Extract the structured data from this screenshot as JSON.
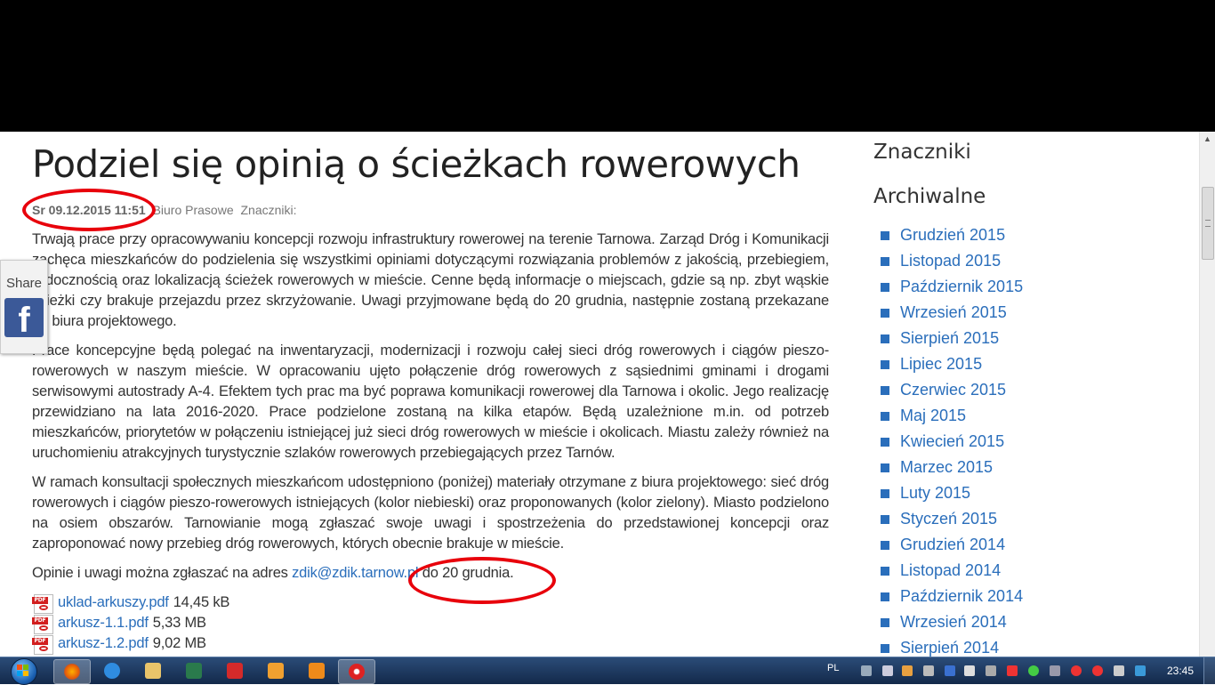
{
  "article": {
    "title": "Podziel się opinią o ścieżkach rowerowych",
    "date": "Sr 09.12.2015 11:51",
    "author": "Biuro Prasowe",
    "tags_label": "Znaczniki:",
    "paragraphs": [
      "Trwają prace przy opracowywaniu koncepcji rozwoju infrastruktury rowerowej na terenie Tarnowa. Zarząd Dróg i Komunikacji zachęca mieszkańców do podzielenia się wszystkimi opiniami dotyczącymi rozwiązania problemów z jakością, przebiegiem, widocznością oraz lokalizacją ścieżek rowerowych w mieście. Cenne będą informacje o miejscach, gdzie są np. zbyt wąskie ścieżki czy brakuje przejazdu przez skrzyżowanie. Uwagi przyjmowane będą do 20 grudnia, następnie zostaną przekazane do biura projektowego.",
      "Prace koncepcyjne będą polegać na inwentaryzacji, modernizacji i rozwoju całej sieci dróg rowerowych i ciągów pieszo-rowerowych w naszym mieście. W opracowaniu ujęto połączenie dróg rowerowych z sąsiednimi gminami i drogami serwisowymi autostrady A-4. Efektem tych prac ma być poprawa komunikacji rowerowej dla Tarnowa i okolic. Jego realizację przewidziano na lata 2016-2020. Prace podzielone zostaną na kilka etapów. Będą uzależnione m.in. od potrzeb mieszkańców, priorytetów w połączeniu istniejącej już sieci dróg rowerowych w mieście i okolicach. Miastu zależy również na uruchomieniu atrakcyjnych turystycznie szlaków rowerowych przebiegających przez Tarnów.",
      "W ramach konsultacji społecznych mieszkańcom udostępniono (poniżej) materiały otrzymane z biura projektowego: sieć dróg rowerowych i ciągów pieszo-rowerowych istniejących (kolor niebieski) oraz proponowanych (kolor zielony). Miasto podzielono na osiem obszarów. Tarnowianie mogą zgłaszać swoje uwagi i spostrzeżenia do przedstawionej koncepcji oraz zaproponować nowy przebieg dróg rowerowych, których obecnie brakuje w mieście."
    ],
    "contact_prefix": "Opinie i uwagi można zgłaszać na adres",
    "contact_email": "zdik@zdik.tarnow.pl",
    "contact_suffix": "do 20 grudnia.",
    "attachments": [
      {
        "name": "uklad-arkuszy.pdf",
        "size": "14,45 kB"
      },
      {
        "name": "arkusz-1.1.pdf",
        "size": "5,33 MB"
      },
      {
        "name": "arkusz-1.2.pdf",
        "size": "9,02 MB"
      }
    ],
    "pdf_icon_text": "PDF"
  },
  "sidebar": {
    "tags_heading": "Znaczniki",
    "archive_heading": "Archiwalne",
    "archive": [
      "Grudzień 2015",
      "Listopad 2015",
      "Październik 2015",
      "Wrzesień 2015",
      "Sierpień 2015",
      "Lipiec 2015",
      "Czerwiec 2015",
      "Maj 2015",
      "Kwiecień 2015",
      "Marzec 2015",
      "Luty 2015",
      "Styczeń 2015",
      "Grudzień 2014",
      "Listopad 2014",
      "Październik 2014",
      "Wrzesień 2014",
      "Sierpień 2014"
    ]
  },
  "share": {
    "label": "Share",
    "facebook_glyph": "f"
  },
  "taskbar": {
    "language": "PL",
    "clock": "23:45",
    "pinned": [
      "firefox-icon",
      "ie-icon",
      "explorer-icon",
      "media-center-icon",
      "paint-icon",
      "outlook-icon",
      "media-player-icon",
      "app-icon"
    ]
  },
  "colors": {
    "link": "#2a6ebb",
    "annotation_circle": "#e8000b",
    "facebook": "#3b5998"
  }
}
